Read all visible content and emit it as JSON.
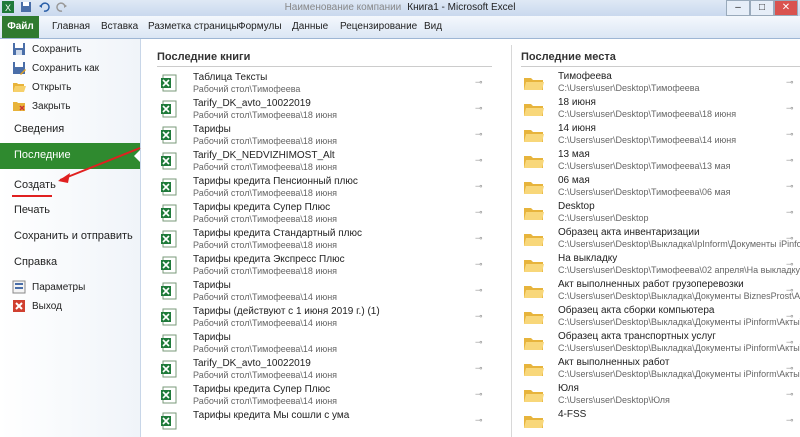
{
  "window": {
    "title": "Книга1 - Microsoft Excel",
    "title_prefix": "Наименование компании"
  },
  "ribbon": {
    "tabs": [
      "Файл",
      "Главная",
      "Вставка",
      "Разметка страницы",
      "Формулы",
      "Данные",
      "Рецензирование",
      "Вид"
    ]
  },
  "sidebar": {
    "save": "Сохранить",
    "save_as": "Сохранить как",
    "open": "Открыть",
    "close": "Закрыть",
    "info": "Сведения",
    "recent": "Последние",
    "new": "Создать",
    "print": "Печать",
    "save_send": "Сохранить и отправить",
    "help": "Справка",
    "options": "Параметры",
    "exit": "Выход"
  },
  "recent_books": {
    "title": "Последние книги",
    "items": [
      {
        "name": "Таблица Тексты",
        "path": "Рабочий стол\\Тимофеева"
      },
      {
        "name": "Tarify_DK_avto_10022019",
        "path": "Рабочий стол\\Тимофеева\\18 июня"
      },
      {
        "name": "Тарифы",
        "path": "Рабочий стол\\Тимофеева\\18 июня"
      },
      {
        "name": "Tarify_DK_NEDVIZHIMOST_Alt",
        "path": "Рабочий стол\\Тимофеева\\18 июня"
      },
      {
        "name": "Тарифы кредита Пенсионный плюс",
        "path": "Рабочий стол\\Тимофеева\\18 июня"
      },
      {
        "name": "Тарифы кредита Супер Плюс",
        "path": "Рабочий стол\\Тимофеева\\18 июня"
      },
      {
        "name": "Тарифы кредита Стандартный плюс",
        "path": "Рабочий стол\\Тимофеева\\18 июня"
      },
      {
        "name": "Тарифы кредита Экспресс Плюс",
        "path": "Рабочий стол\\Тимофеева\\18 июня"
      },
      {
        "name": "Тарифы",
        "path": "Рабочий стол\\Тимофеева\\14 июня"
      },
      {
        "name": "Тарифы (действуют с 1 июня 2019 г.) (1)",
        "path": "Рабочий стол\\Тимофеева\\14 июня"
      },
      {
        "name": "Тарифы",
        "path": "Рабочий стол\\Тимофеева\\14 июня"
      },
      {
        "name": "Tarify_DK_avto_10022019",
        "path": "Рабочий стол\\Тимофеева\\14 июня"
      },
      {
        "name": "Тарифы кредита Супер Плюс",
        "path": "Рабочий стол\\Тимофеева\\14 июня"
      },
      {
        "name": "Тарифы кредита Мы сошли с ума",
        "path": ""
      }
    ]
  },
  "recent_places": {
    "title": "Последние места",
    "items": [
      {
        "name": "Тимофеева",
        "path": "C:\\Users\\user\\Desktop\\Тимофеева"
      },
      {
        "name": "18 июня",
        "path": "C:\\Users\\user\\Desktop\\Тимофеева\\18 июня"
      },
      {
        "name": "14 июня",
        "path": "C:\\Users\\user\\Desktop\\Тимофеева\\14 июня"
      },
      {
        "name": "13 мая",
        "path": "C:\\Users\\user\\Desktop\\Тимофеева\\13 мая"
      },
      {
        "name": "06 мая",
        "path": "C:\\Users\\user\\Desktop\\Тимофеева\\06 мая"
      },
      {
        "name": "Desktop",
        "path": "C:\\Users\\user\\Desktop"
      },
      {
        "name": "Образец акта инвентаризации",
        "path": "C:\\Users\\user\\Desktop\\Выкладка\\IpInform\\Документы iPinform"
      },
      {
        "name": "На выкладку",
        "path": "C:\\Users\\user\\Desktop\\Тимофеева\\02 апреля\\На выкладку"
      },
      {
        "name": "Акт выполненных работ грузоперевозки",
        "path": "C:\\Users\\user\\Desktop\\Выкладка\\Документы BiznesProst\\Акты"
      },
      {
        "name": "Образец акта сборки компьютера",
        "path": "C:\\Users\\user\\Desktop\\Выкладка\\Документы iPinform\\Акты\\Об"
      },
      {
        "name": "Образец акта транспортных услуг",
        "path": "C:\\Users\\user\\Desktop\\Выкладка\\Документы iPinform\\Акты\\Об"
      },
      {
        "name": "Акт выполненных работ",
        "path": "C:\\Users\\user\\Desktop\\Выкладка\\Документы iPinform\\Акты\\Об"
      },
      {
        "name": "Юля",
        "path": "C:\\Users\\user\\Desktop\\Юля"
      },
      {
        "name": "4-FSS",
        "path": ""
      }
    ]
  },
  "colors": {
    "file_tab": "#2f7a2f",
    "active_item": "#2f8a2f",
    "annotation": "#e02020"
  }
}
